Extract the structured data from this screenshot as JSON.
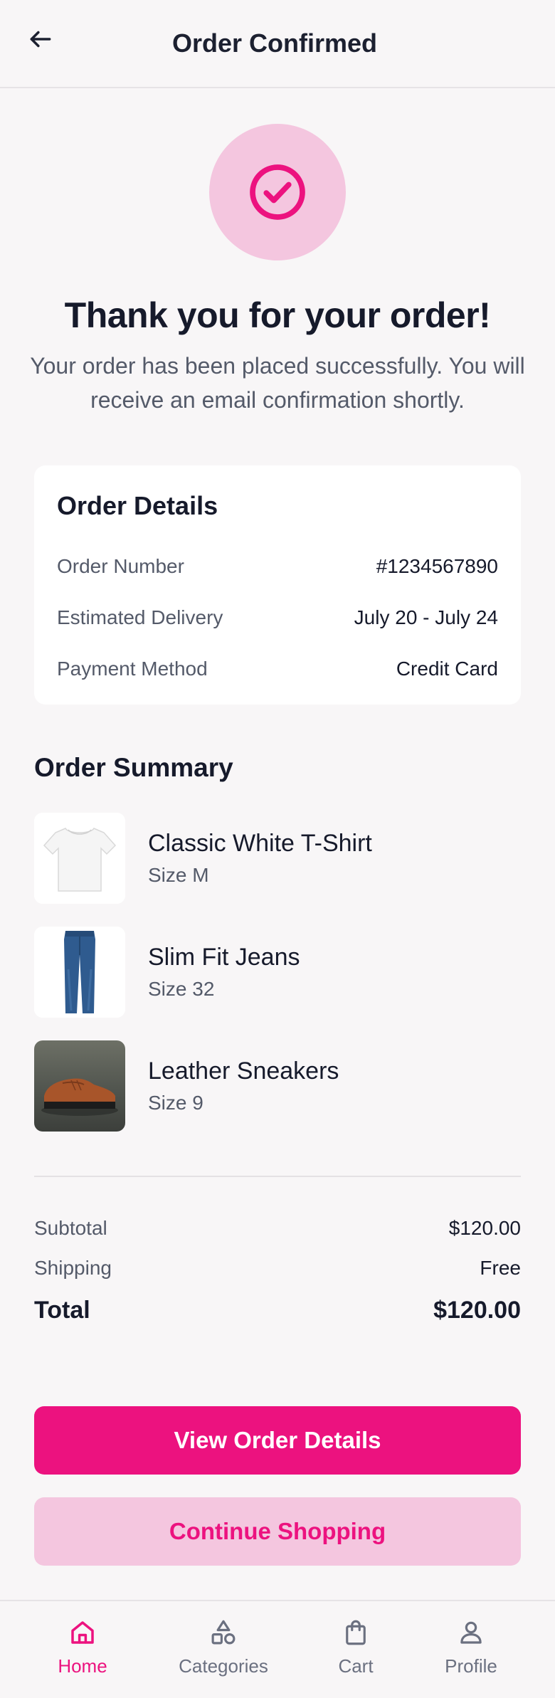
{
  "header": {
    "title": "Order Confirmed"
  },
  "confirmation": {
    "title": "Thank you for your order!",
    "message": "Your order has been placed successfully. You will receive an email confirmation shortly."
  },
  "order_details": {
    "title": "Order Details",
    "rows": [
      {
        "label": "Order Number",
        "value": "#1234567890"
      },
      {
        "label": "Estimated Delivery",
        "value": "July 20 - July 24"
      },
      {
        "label": "Payment Method",
        "value": "Credit Card"
      }
    ]
  },
  "order_summary": {
    "title": "Order Summary",
    "items": [
      {
        "name": "Classic White T-Shirt",
        "size": "Size M",
        "image": "white-tshirt"
      },
      {
        "name": "Slim Fit Jeans",
        "size": "Size 32",
        "image": "blue-jeans"
      },
      {
        "name": "Leather Sneakers",
        "size": "Size 9",
        "image": "brown-leather-sneaker"
      }
    ]
  },
  "totals": {
    "subtotal_label": "Subtotal",
    "subtotal_value": "$120.00",
    "shipping_label": "Shipping",
    "shipping_value": "Free",
    "total_label": "Total",
    "total_value": "$120.00"
  },
  "actions": {
    "primary_label": "View Order Details",
    "secondary_label": "Continue Shopping"
  },
  "nav": {
    "items": [
      {
        "label": "Home",
        "icon": "home-icon",
        "active": true
      },
      {
        "label": "Categories",
        "icon": "categories-icon",
        "active": false
      },
      {
        "label": "Cart",
        "icon": "cart-icon",
        "active": false
      },
      {
        "label": "Profile",
        "icon": "profile-icon",
        "active": false
      }
    ]
  },
  "colors": {
    "accent": "#ec127f",
    "accent_light": "#f4c6df",
    "background": "#f8f6f7",
    "text_primary": "#161a2b",
    "text_secondary": "#545a69"
  }
}
